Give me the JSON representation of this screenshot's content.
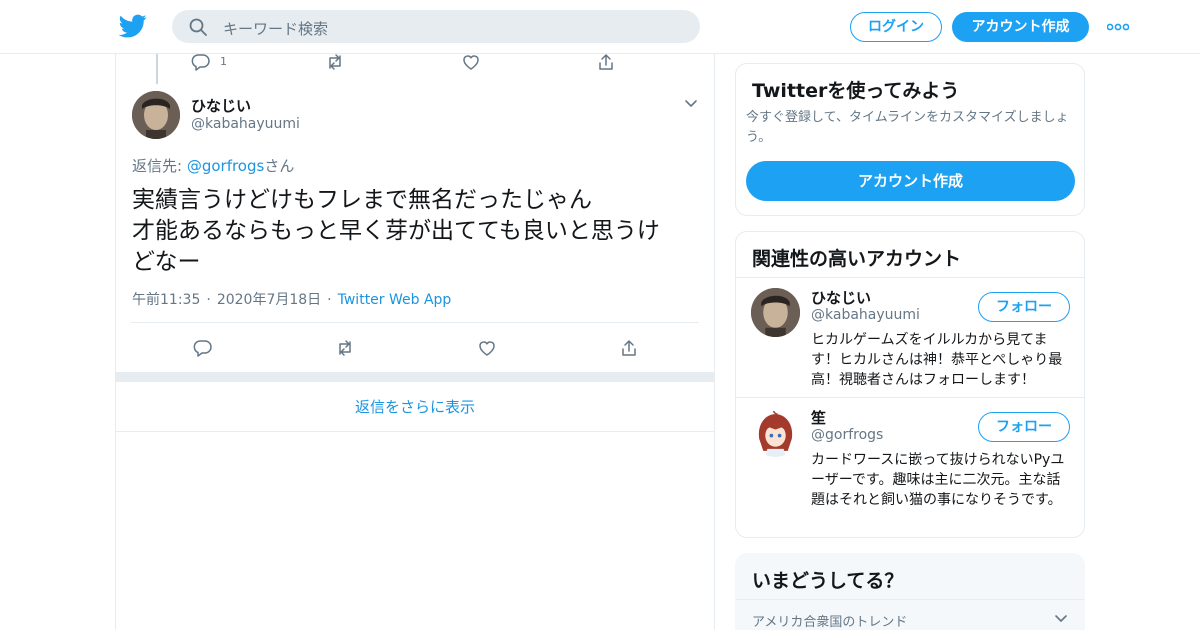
{
  "header": {
    "search_placeholder": "キーワード検索",
    "login_label": "ログイン",
    "signup_label": "アカウント作成"
  },
  "prev_tweet": {
    "reply_count": "1"
  },
  "tweet": {
    "name": "ひなじい",
    "handle": "@kabahayuumi",
    "replying_prefix": "返信先: ",
    "replying_to": "@gorfrogs",
    "replying_suffix": "さん",
    "text_lines": [
      "実績言うけどけもフレまで無名だったじゃん",
      "才能あるならもっと早く芽が出てても良いと思うけ",
      "どなー"
    ],
    "time": "午前11:35",
    "date": "2020年7月18日",
    "source": "Twitter Web App"
  },
  "more_replies_label": "返信をさらに表示",
  "sidebar": {
    "signup_card": {
      "title": "Twitterを使ってみよう",
      "subtitle": "今すぐ登録して、タイムラインをカスタマイズしましょう。",
      "button_label": "アカウント作成"
    },
    "related": {
      "title": "関連性の高いアカウント",
      "follow_label": "フォロー",
      "accounts": [
        {
          "name": "ひなじい",
          "handle": "@kabahayuumi",
          "bio": "ヒカルゲームズをイルルカから見てます！ヒカルさんは神！恭平とぺしゃり最高！視聴者さんはフォローします！"
        },
        {
          "name": "笙",
          "handle": "@gorfrogs",
          "bio": "カードワースに嵌って抜けられないPyユーザーです。趣味は主に二次元。主な話題はそれと飼い猫の事になりそうです。"
        }
      ]
    },
    "trends": {
      "title": "いまどうしてる？",
      "location": "アメリカ合衆国のトレンド"
    }
  },
  "colors": {
    "brand": "#1da1f2",
    "link": "#1b95e0",
    "secondary_text": "#657786",
    "border": "#e6ecf0"
  }
}
